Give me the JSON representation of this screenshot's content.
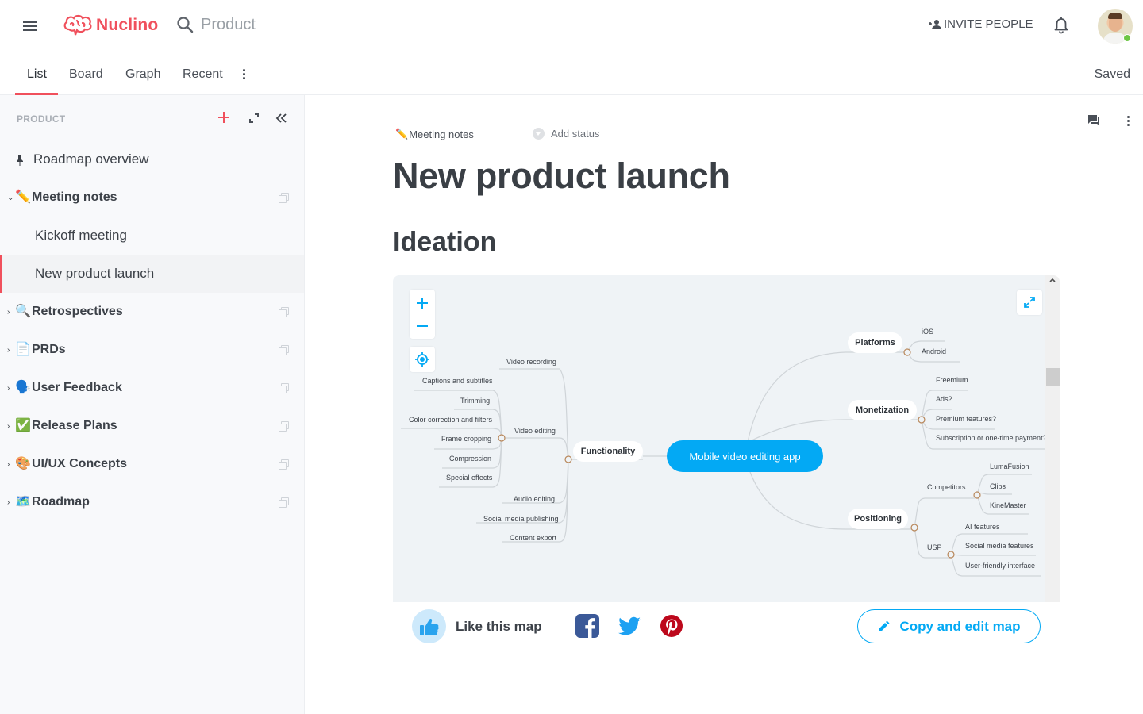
{
  "app": {
    "name": "Nuclino",
    "brand_color": "#f0505c"
  },
  "header": {
    "search_text": "Product",
    "invite_label": "INVITE PEOPLE",
    "avatar_online_color": "#6dc644"
  },
  "tabs": {
    "items": [
      {
        "label": "List",
        "active": true
      },
      {
        "label": "Board",
        "active": false
      },
      {
        "label": "Graph",
        "active": false
      },
      {
        "label": "Recent",
        "active": false
      }
    ],
    "save_status": "Saved"
  },
  "sidebar": {
    "workspace_label": "PRODUCT",
    "items": [
      {
        "label": "Roadmap overview",
        "icon": "pin-icon",
        "emoji": "",
        "pinned": true
      },
      {
        "label": "Meeting notes",
        "emoji": "✏️",
        "expanded": true,
        "collection": true
      },
      {
        "label": "Kickoff meeting",
        "child": true
      },
      {
        "label": "New product launch",
        "child": true,
        "selected": true
      },
      {
        "label": "Retrospectives",
        "emoji": "🔍",
        "collection": true
      },
      {
        "label": "PRDs",
        "emoji": "📄",
        "collection": true
      },
      {
        "label": "User Feedback",
        "emoji": "🗣️",
        "collection": true
      },
      {
        "label": "Release Plans",
        "emoji": "✅",
        "collection": true
      },
      {
        "label": "UI/UX Concepts",
        "emoji": "🎨",
        "collection": true
      },
      {
        "label": "Roadmap",
        "emoji": "🗺️",
        "collection": true
      }
    ]
  },
  "document": {
    "breadcrumb_emoji": "✏️",
    "breadcrumb": "Meeting notes",
    "status_label": "Add status",
    "title": "New product launch",
    "section_heading": "Ideation"
  },
  "mindmap": {
    "root": "Mobile video editing app",
    "accent_color": "#03a9f4",
    "left": {
      "label": "Functionality",
      "children": [
        {
          "label": "Video recording"
        },
        {
          "label": "Video editing",
          "children": [
            "Captions and subtitles",
            "Trimming",
            "Color correction and filters",
            "Frame cropping",
            "Compression",
            "Special effects"
          ]
        },
        {
          "label": "Audio editing"
        },
        {
          "label": "Social media publishing"
        },
        {
          "label": "Content export"
        }
      ]
    },
    "right": [
      {
        "label": "Platforms",
        "children": [
          "iOS",
          "Android"
        ]
      },
      {
        "label": "Monetization",
        "children": [
          "Freemium",
          "Ads?",
          "Premium features?",
          "Subscription or one-time payment?"
        ]
      },
      {
        "label": "Positioning",
        "children": [
          {
            "label": "Competitors",
            "children": [
              "LumaFusion",
              "Clips",
              "KineMaster"
            ]
          },
          {
            "label": "USP",
            "children": [
              "AI features",
              "Social media features",
              "User-friendly interface"
            ]
          }
        ]
      }
    ],
    "footer": {
      "like_label": "Like this map",
      "share": [
        "facebook",
        "twitter",
        "pinterest"
      ],
      "copy_label": "Copy and edit map"
    }
  }
}
